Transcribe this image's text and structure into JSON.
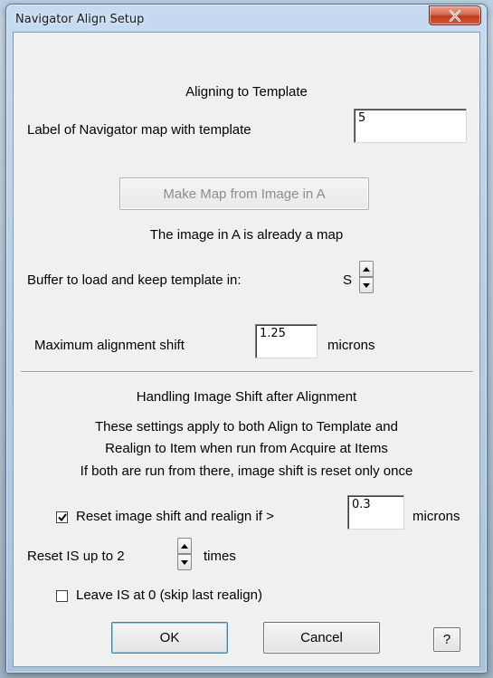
{
  "window": {
    "title": "Navigator Align Setup",
    "close_icon": "close-icon"
  },
  "aligning": {
    "heading": "Aligning to Template",
    "label_text": "Label of Navigator map with template",
    "label_value": "5",
    "make_map_button": "Make Map from Image in A",
    "make_map_enabled": false,
    "status_text": "The image in A is already a map",
    "buffer_text": "Buffer to load and keep template in:",
    "buffer_value": "S",
    "max_shift_text": "Maximum alignment shift",
    "max_shift_value": "1.25",
    "max_shift_unit": "microns"
  },
  "image_shift": {
    "heading": "Handling Image Shift after Alignment",
    "info_line1": "These settings apply to both Align to Template and",
    "info_line2": "Realign to Item when run from Acquire at Items",
    "info_line3": "If both are run from there, image shift is reset only once",
    "reset_label": "Reset image shift and realign if >",
    "reset_checked": true,
    "reset_value": "0.3",
    "reset_unit": "microns",
    "reset_up_to_text": "Reset IS up to 2",
    "times_text": "times",
    "leave_label": "Leave IS at 0 (skip last realign)",
    "leave_checked": false
  },
  "buttons": {
    "ok": "OK",
    "cancel": "Cancel",
    "help": "?"
  }
}
